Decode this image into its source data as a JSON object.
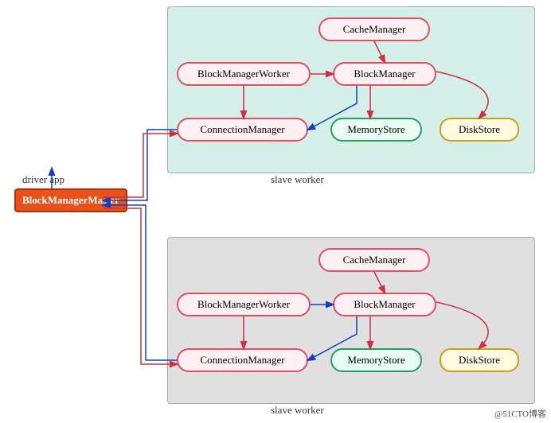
{
  "panels": [
    {
      "id": "panel-top",
      "type": "green",
      "label": "slave worker"
    },
    {
      "id": "panel-bottom",
      "type": "gray",
      "label": "slave worker"
    }
  ],
  "nodes": {
    "master": {
      "label": "BlockManagerMaster"
    },
    "top_cache": {
      "label": "CacheManager"
    },
    "top_bmw": {
      "label": "BlockManagerWorker"
    },
    "top_bm": {
      "label": "BlockManager"
    },
    "top_cm": {
      "label": "ConnectionManager"
    },
    "top_ms": {
      "label": "MemoryStore"
    },
    "top_ds": {
      "label": "DiskStore"
    },
    "bot_cache": {
      "label": "CacheManager"
    },
    "bot_bmw": {
      "label": "BlockManagerWorker"
    },
    "bot_bm": {
      "label": "BlockManager"
    },
    "bot_cm": {
      "label": "ConnectionManager"
    },
    "bot_ms": {
      "label": "MemoryStore"
    },
    "bot_ds": {
      "label": "DiskStore"
    }
  },
  "misc": {
    "driver_label": "driver app",
    "watermark": "@51CTO博客"
  }
}
